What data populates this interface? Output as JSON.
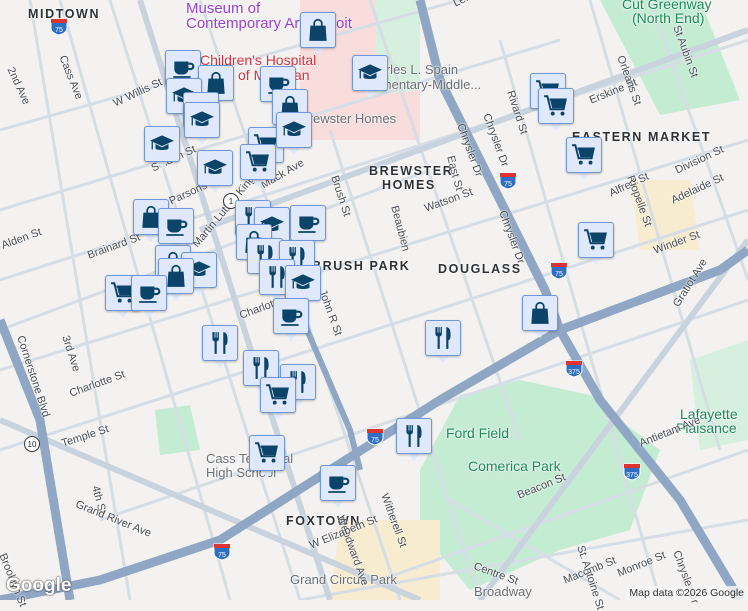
{
  "neighborhoods": {
    "midtown": "MIDTOWN",
    "brewster": "BREWSTER",
    "brewster2": "HOMES",
    "eastern_market": "EASTERN MARKET",
    "douglass": "DOUGLASS",
    "brush_park": "BRUSH PARK",
    "foxtown": "FOXTOWN"
  },
  "pois": {
    "moca1": "Museum of",
    "moca2": "Contemporary Art Detroit",
    "hospital1": "Children's Hospital",
    "hospital2": "of Michigan",
    "spain1": "Charles L. Spain",
    "spain2": "Elementary-Middle...",
    "brewster_homes": "Brewster Homes",
    "cut1": "Cut Greenway",
    "cut2": "(North End)",
    "ford_field": "Ford Field",
    "comerica": "Comerica Park",
    "cass_tech1": "Cass Technical",
    "cass_tech2": "High School",
    "grand_circus": "Grand Circus Park",
    "broadway": "Broadway",
    "lafayette1": "Lafayette",
    "lafayette2": "Plaisance"
  },
  "streets": {
    "cass": "Cass Ave",
    "second": "2nd Ave",
    "third": "3rd Ave",
    "fourth": "4th St",
    "willis": "W Willis St",
    "selden": "Selden St",
    "parsons": "Parsons St",
    "mack": "Mack Ave",
    "brush": "Brush St",
    "mlk": "Martin Luther King Jr Blvd",
    "brainard": "Brainard St",
    "alden": "Alden St",
    "charlotte": "Charlotte St",
    "charlotte2": "Charlotte St",
    "temple": "Temple St",
    "cornerstone": "Cornerstone Blvd",
    "grand_river": "Grand River Ave",
    "brooklyn": "Brooklyn St",
    "john_r": "John R St",
    "beaubien": "Beaubien",
    "watson": "Watson St",
    "east": "East St",
    "chrysler1": "Chrysler Dr",
    "chrysler2": "Chrysler Dr",
    "chrysler3": "Chrysler Dr",
    "chrysler4": "Chrysler Dr",
    "erskine": "Erskine St",
    "orleans": "Orleans St",
    "st_aubin": "St Aubin St",
    "alfred": "Alfred St",
    "riopelle": "Riopelle St",
    "winder": "Winder St",
    "gratiot": "Gratiot Ave",
    "antietam": "Antietam Ave",
    "beacon": "Beacon St",
    "witherell": "Witherell St",
    "woodward": "Woodward Ave",
    "elizabeth": "W Elizabeth St",
    "centre": "Centre St",
    "macomb": "Macomb St",
    "monroe": "Monroe St",
    "st_antoine": "St. Antoine St",
    "division": "Division St",
    "adelaide": "Adelaide St",
    "leland": "Leland St",
    "rivard": "Rivard St"
  },
  "shields": {
    "i75": "75",
    "i375": "375",
    "m10": "10",
    "m1": "1"
  },
  "marker_types": [
    "coffee",
    "shopping",
    "school",
    "grocery",
    "restaurant"
  ],
  "branding": {
    "logo": "Google",
    "attribution": "Map data ©2026 Google"
  },
  "colors": {
    "marker_fill": "#dfe9fb",
    "marker_border": "#6f95db",
    "marker_icon": "#0b4468",
    "freeway": "#8fa6c4",
    "park": "#c4ecd3",
    "road": "#d6dde5"
  }
}
